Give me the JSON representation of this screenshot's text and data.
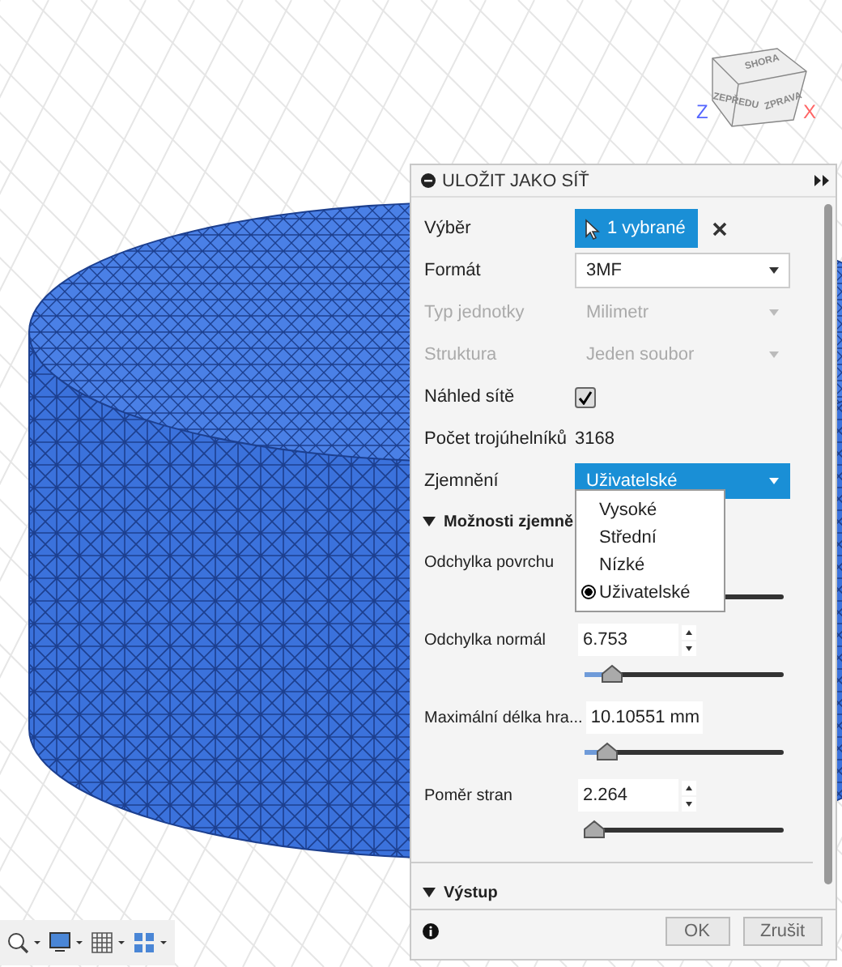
{
  "viewcube": {
    "faces": [
      "SHORA",
      "ZEPŘEDU",
      "ZPRAVA"
    ],
    "axes": [
      {
        "label": "Z",
        "color": "#5566ff"
      },
      {
        "label": "X",
        "color": "#ff6666"
      }
    ]
  },
  "panel": {
    "title": "ULOŽIT JAKO SÍŤ",
    "rows": [
      {
        "kind": "selection",
        "label": "Výběr",
        "value": "1 vybrané"
      },
      {
        "kind": "select",
        "label": "Formát",
        "value": "3MF",
        "disabled": false,
        "active": false
      },
      {
        "kind": "select",
        "label": "Typ jednotky",
        "value": "Milimetr",
        "disabled": true,
        "active": false
      },
      {
        "kind": "select",
        "label": "Struktura",
        "value": "Jeden soubor",
        "disabled": true,
        "active": false
      },
      {
        "kind": "checkbox",
        "label": "Náhled sítě",
        "checked": true
      },
      {
        "kind": "text",
        "label": "Počet trojúhelníků",
        "value": "3168"
      },
      {
        "kind": "select",
        "label": "Zjemnění",
        "value": "Uživatelské",
        "disabled": false,
        "active": true
      }
    ],
    "dropdown": {
      "options": [
        {
          "label": "Vysoké",
          "selected": false
        },
        {
          "label": "Střední",
          "selected": false
        },
        {
          "label": "Nízké",
          "selected": false
        },
        {
          "label": "Uživatelské",
          "selected": true
        }
      ]
    },
    "sections": [
      {
        "title": "Možnosti zjemně",
        "params": [
          {
            "label": "Odchylka povrchu"
          },
          {
            "label": "Odchylka normál",
            "value": "6.753",
            "spinner": true,
            "level": 0.14
          },
          {
            "label": "Maximální délka hra...",
            "value": "10.10551 mm",
            "spinner": false,
            "level": 0.11
          },
          {
            "label": "Poměr stran",
            "value": "2.264",
            "spinner": true,
            "level": 0.05
          }
        ]
      },
      {
        "title": "Výstup"
      }
    ],
    "buttons": [
      "OK",
      "Zrušit"
    ]
  }
}
